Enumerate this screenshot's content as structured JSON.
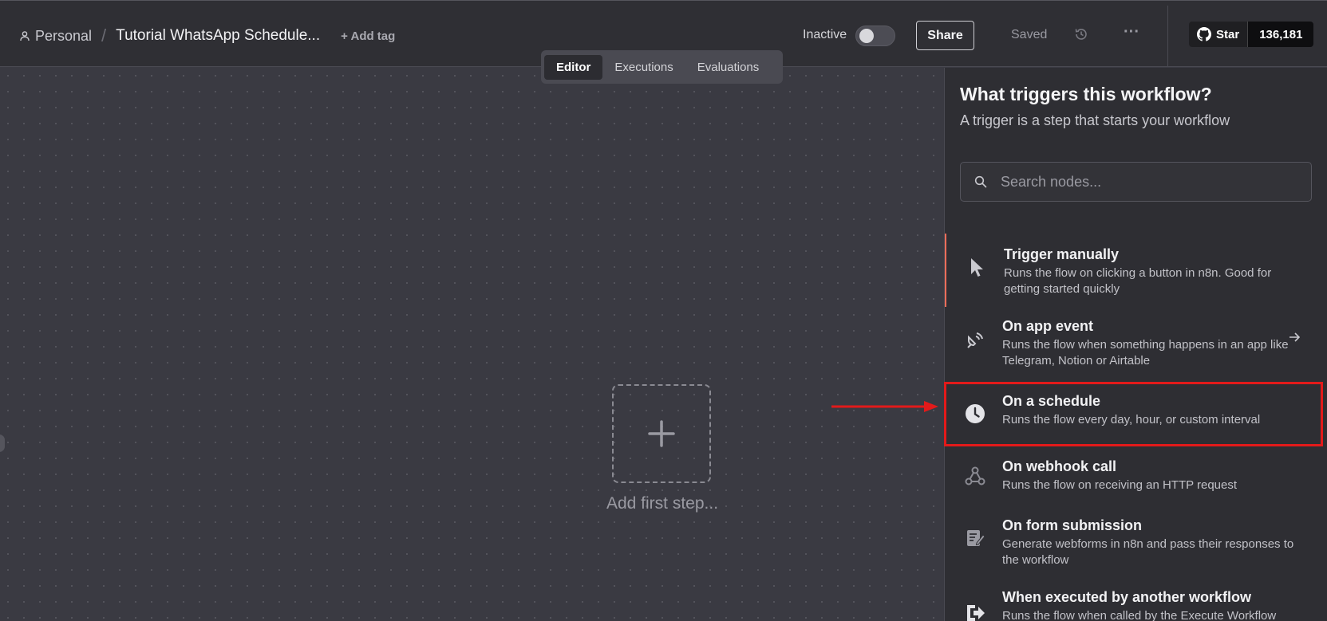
{
  "header": {
    "breadcrumb_personal": "Personal",
    "breadcrumb_sep": "/",
    "workflow_title": "Tutorial WhatsApp Schedule...",
    "add_tag": "+ Add tag",
    "inactive_label": "Inactive",
    "share_label": "Share",
    "saved_label": "Saved",
    "more_label": "···",
    "github_star_label": "Star",
    "github_star_count": "136,181"
  },
  "tabs": [
    {
      "label": "Editor",
      "active": true
    },
    {
      "label": "Executions",
      "active": false
    },
    {
      "label": "Evaluations",
      "active": false
    }
  ],
  "canvas": {
    "add_first_step": "Add first step..."
  },
  "panel": {
    "title": "What triggers this workflow?",
    "subtitle": "A trigger is a step that starts your workflow",
    "search_placeholder": "Search nodes...",
    "items": [
      {
        "title": "Trigger manually",
        "desc": "Runs the flow on clicking a button in n8n. Good for getting started quickly",
        "icon": "cursor-icon"
      },
      {
        "title": "On app event",
        "desc": "Runs the flow when something happens in an app like Telegram, Notion or Airtable",
        "icon": "satellite-icon"
      },
      {
        "title": "On a schedule",
        "desc": "Runs the flow every day, hour, or custom interval",
        "icon": "clock-icon"
      },
      {
        "title": "On webhook call",
        "desc": "Runs the flow on receiving an HTTP request",
        "icon": "webhook-icon"
      },
      {
        "title": "On form submission",
        "desc": "Generate webforms in n8n and pass their responses to the workflow",
        "icon": "form-icon"
      },
      {
        "title": "When executed by another workflow",
        "desc": "Runs the flow when called by the Execute Workflow",
        "icon": "execute-icon"
      }
    ]
  },
  "colors": {
    "accent": "#ff6d5a",
    "annotation_red": "#e31a1a",
    "panel_bg": "#2e2e33",
    "header_bg": "#2f2f34"
  }
}
